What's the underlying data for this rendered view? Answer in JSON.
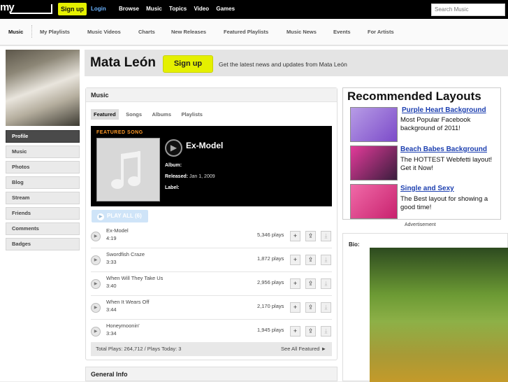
{
  "topbar": {
    "logo": "my",
    "signup": "Sign up",
    "login": "Login",
    "nav": [
      "Browse",
      "Music",
      "Topics",
      "Video",
      "Games"
    ],
    "search_placeholder": "Search Music"
  },
  "subnav": {
    "items": [
      "Music",
      "My Playlists",
      "Music Videos",
      "Charts",
      "New Releases",
      "Featured Playlists",
      "Music News",
      "Events",
      "For Artists"
    ]
  },
  "sidebar": {
    "items": [
      "Profile",
      "Music",
      "Photos",
      "Blog",
      "Stream",
      "Friends",
      "Comments",
      "Badges"
    ]
  },
  "header": {
    "artist": "Mata León",
    "signup": "Sign up",
    "tagline": "Get the latest news and updates from Mata León"
  },
  "music": {
    "title": "Music",
    "tabs": [
      "Featured",
      "Songs",
      "Albums",
      "Playlists"
    ],
    "featured": {
      "label": "FEATURED SONG",
      "title": "Ex-Model",
      "album_label": "Album:",
      "album": "",
      "released_label": "Released:",
      "released": "Jan 1, 2009",
      "label_label": "Label:",
      "label_value": ""
    },
    "play_all": "PLAY ALL (6)",
    "tracks": [
      {
        "name": "Ex-Model",
        "duration": "4:19",
        "plays": "5,346 plays"
      },
      {
        "name": "Swordfish Craze",
        "duration": "3:33",
        "plays": "1,872 plays"
      },
      {
        "name": "When Will They Take Us",
        "duration": "3:40",
        "plays": "2,956 plays"
      },
      {
        "name": "When It Wears Off",
        "duration": "3:44",
        "plays": "2,170 plays"
      },
      {
        "name": "Honeymoonin'",
        "duration": "3:34",
        "plays": "1,945 plays"
      }
    ],
    "totals": "Total Plays: 264,712 / Plays Today: 3",
    "see_all": "See All Featured ►"
  },
  "general_info": "General Info",
  "ad": {
    "title": "Recommended Layouts",
    "items": [
      {
        "link": "Purple Heart Background",
        "text": "Most Popular Facebook background of 2011!"
      },
      {
        "link": "Beach Babes Background",
        "text": "The HOTTEST Webfetti layout! Get it Now!"
      },
      {
        "link": "Single and Sexy",
        "text": "The Best layout for showing a good time!"
      }
    ],
    "label": "Advertisement"
  },
  "bio": {
    "label": "Bio:"
  }
}
